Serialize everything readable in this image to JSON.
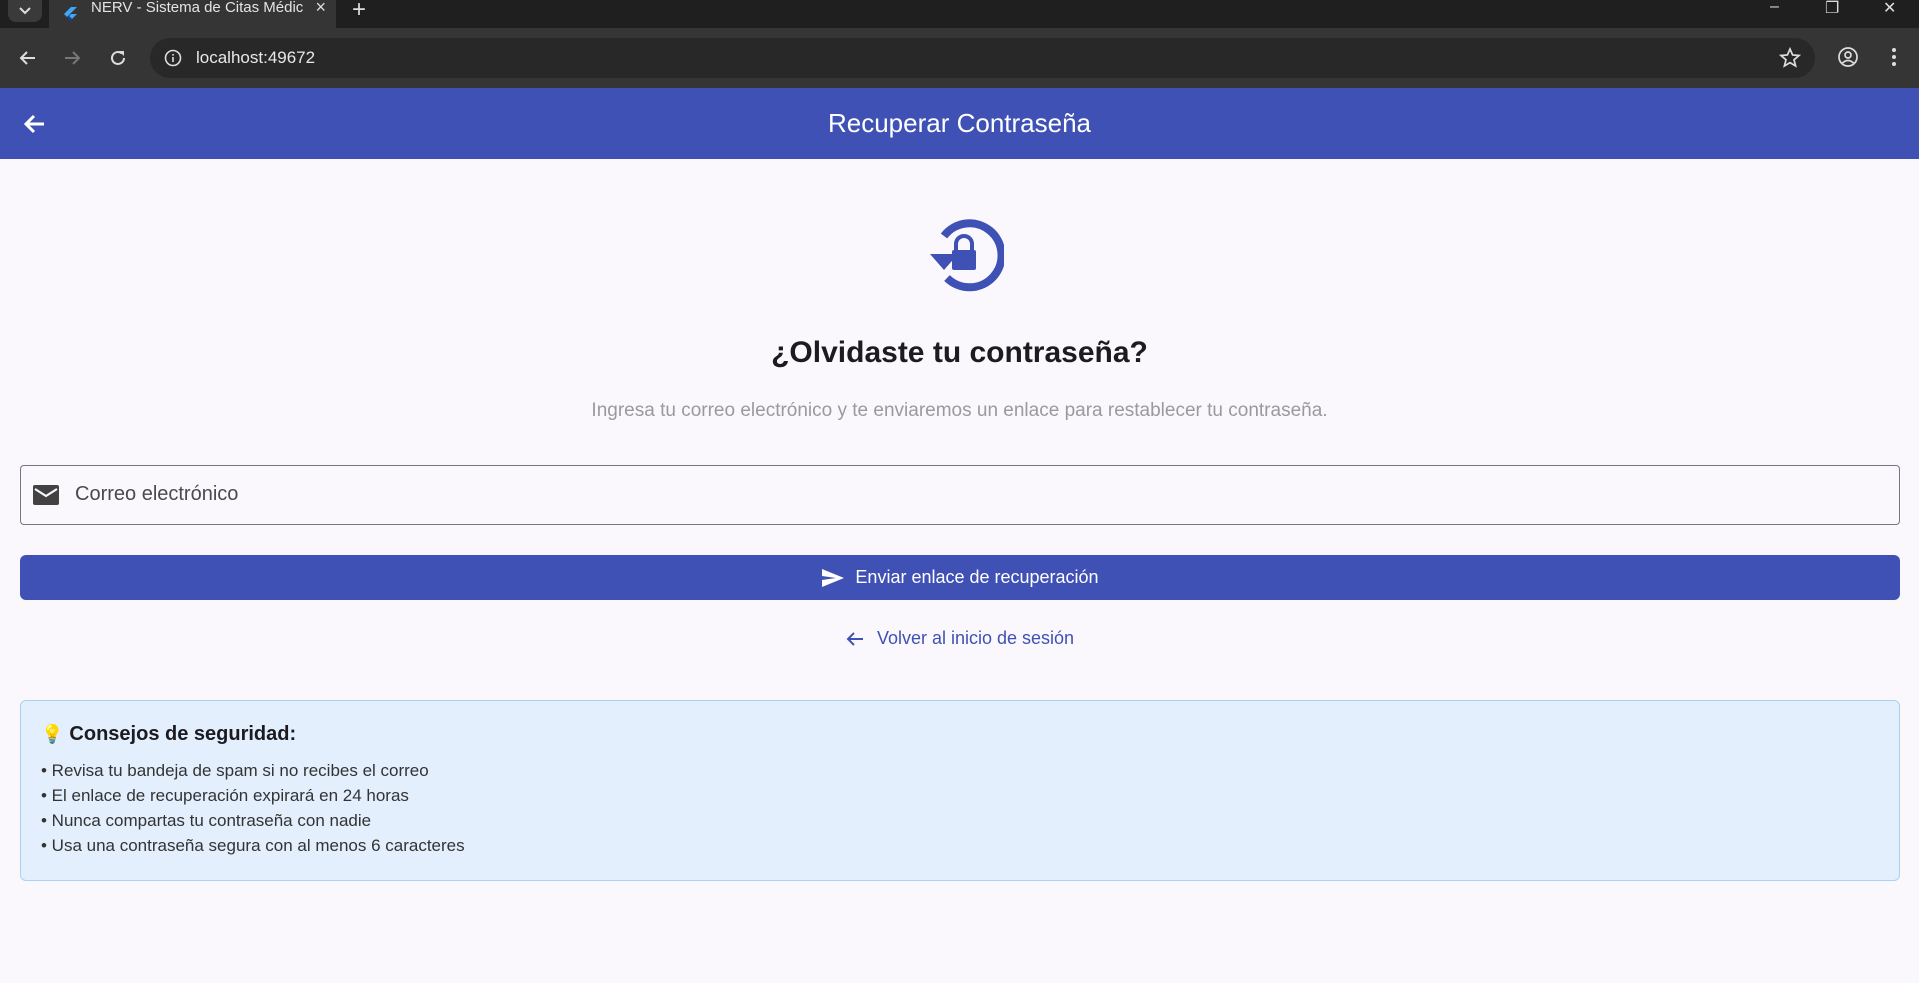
{
  "browser": {
    "tab_title": "NERV - Sistema de Citas Médicas",
    "url": "localhost:49672"
  },
  "appbar": {
    "title": "Recuperar Contraseña"
  },
  "main": {
    "heading": "¿Olvidaste tu contraseña?",
    "subtext": "Ingresa tu correo electrónico y te enviaremos un enlace para restablecer tu contraseña.",
    "email_placeholder": "Correo electrónico",
    "email_value": "",
    "send_label": "Enviar enlace de recuperación",
    "back_label": "Volver al inicio de sesión"
  },
  "tips": {
    "title": "Consejos de seguridad:",
    "items": [
      "• Revisa tu bandeja de spam si no recibes el correo",
      "• El enlace de recuperación expirará en 24 horas",
      "• Nunca compartas tu contraseña con nadie",
      "• Usa una contraseña segura con al menos 6 caracteres"
    ]
  },
  "colors": {
    "primary": "#3f51b5",
    "background": "#faf8fd",
    "tips_background": "#e3effd",
    "tips_border": "#a9d1f0"
  },
  "icons": [
    "chevron-down-icon",
    "flutter-favicon-icon",
    "close-icon",
    "plus-icon",
    "minimize-icon",
    "restore-icon",
    "back-icon",
    "forward-icon",
    "reload-icon",
    "info-icon",
    "star-icon",
    "profile-icon",
    "more-icon",
    "lock-reset-icon",
    "mail-icon",
    "send-icon",
    "arrow-left-icon",
    "lightbulb-icon"
  ]
}
